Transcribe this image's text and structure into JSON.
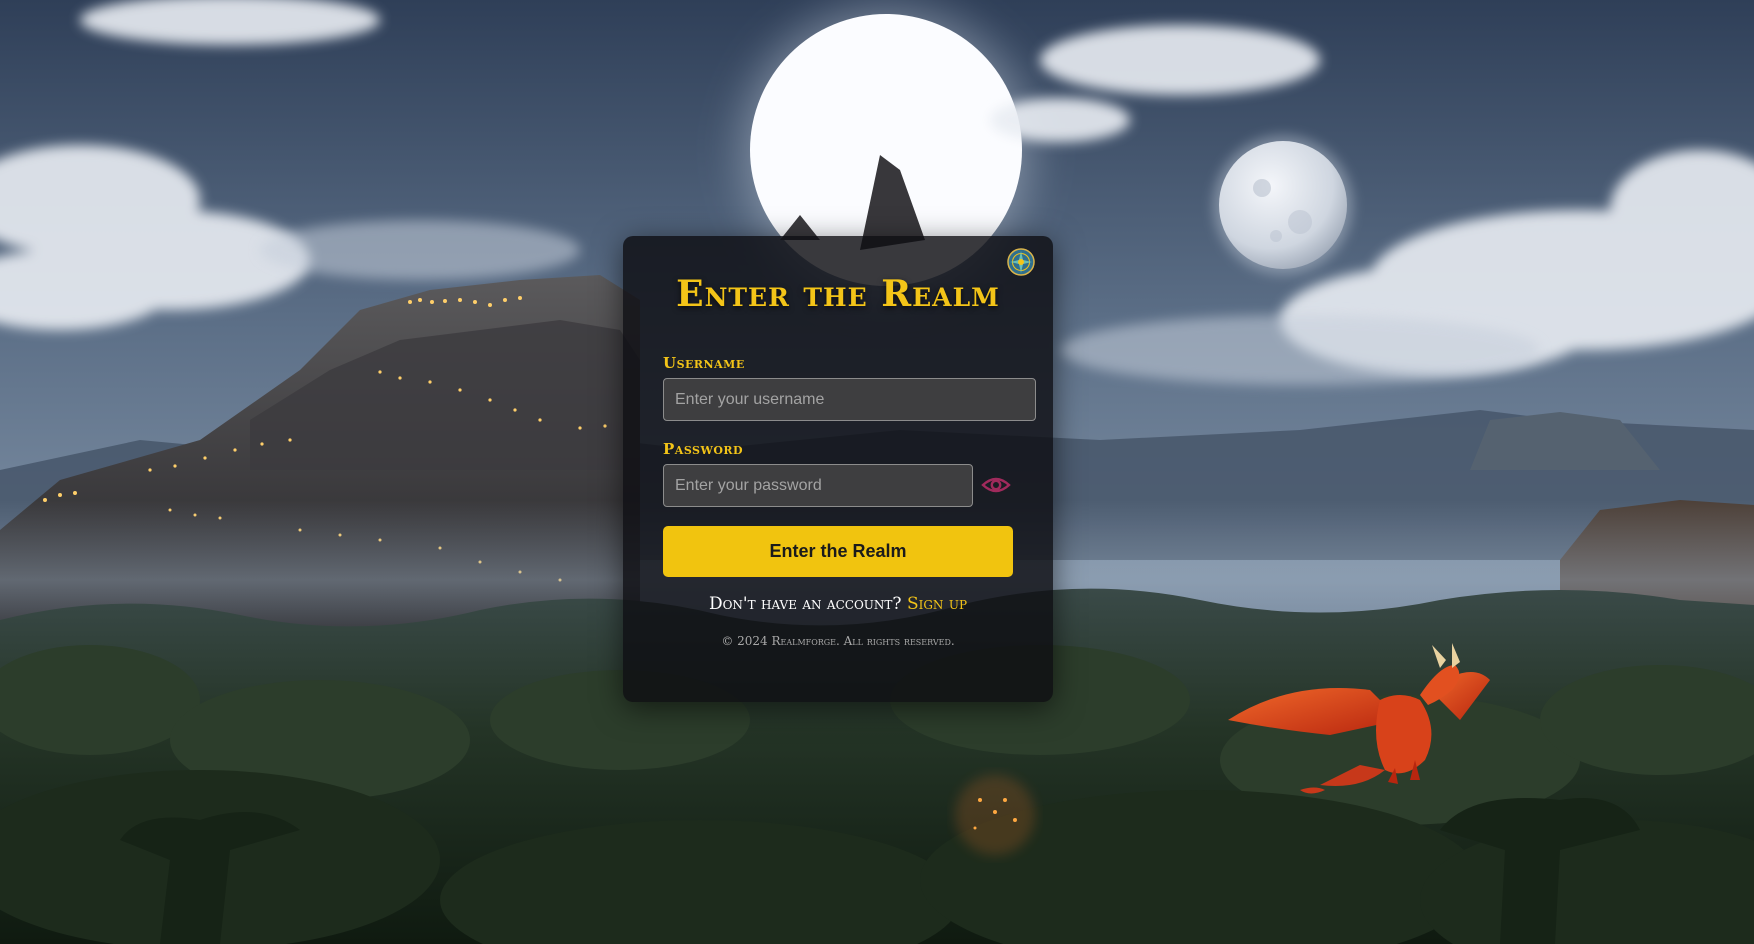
{
  "login": {
    "title": "Enter the Realm",
    "username_label": "Username",
    "username_placeholder": "Enter your username",
    "password_label": "Password",
    "password_placeholder": "Enter your password",
    "submit_label": "Enter the Realm",
    "signup_prompt": "Don't have an account?",
    "signup_link": "Sign up",
    "footer": "© 2024 Realmforge. All rights reserved."
  },
  "icons": {
    "emblem": "realm-emblem-icon",
    "password_toggle": "eye-icon"
  },
  "colors": {
    "accent": "#f3c418",
    "button": "#f1c40f",
    "eye": "#a02a5c"
  }
}
